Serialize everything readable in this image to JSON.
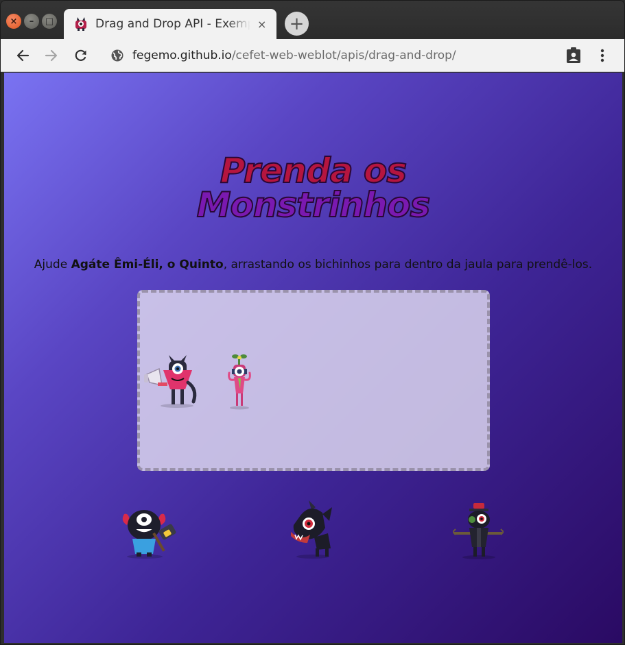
{
  "browser": {
    "tab": {
      "title": "Drag and Drop API - Exemplo",
      "close": "×",
      "favicon_icon": "monster-favicon-icon"
    },
    "new_tab": "+",
    "window_buttons": {
      "close": "×",
      "minimize": "–",
      "maximize": "□"
    },
    "url_host": "fegemo.github.io",
    "url_path": "/cefet-web-weblot/apis/drag-and-drop/",
    "icons": [
      "back-arrow-icon",
      "forward-arrow-icon",
      "reload-icon",
      "globe-icon",
      "clipboard-person-icon",
      "more-vert-icon"
    ]
  },
  "page": {
    "heading_line1": "Prenda os",
    "heading_line2": "Monstrinhos",
    "intro_before": "Ajude ",
    "intro_bold": "Agáte Êmi-Éli, o Quinto",
    "intro_after": ", arrastando os bichinhos para dentro da jaula para prendê-los.",
    "colors": {
      "background_top_left": "#7a73f2",
      "background_bottom_right": "#2a0a63",
      "heading_line1": "#b5153f",
      "heading_line2": "#7a19b0",
      "jail_fill": "#dcd6ee",
      "jail_border": "#9a92ab"
    },
    "monsters_in_jail": [
      "megaphone-monster-icon",
      "cyclops-flower-monster-icon"
    ],
    "monsters_free": [
      "hammer-monster-icon",
      "dark-wolf-monster-icon",
      "scarecrow-monster-icon"
    ]
  }
}
